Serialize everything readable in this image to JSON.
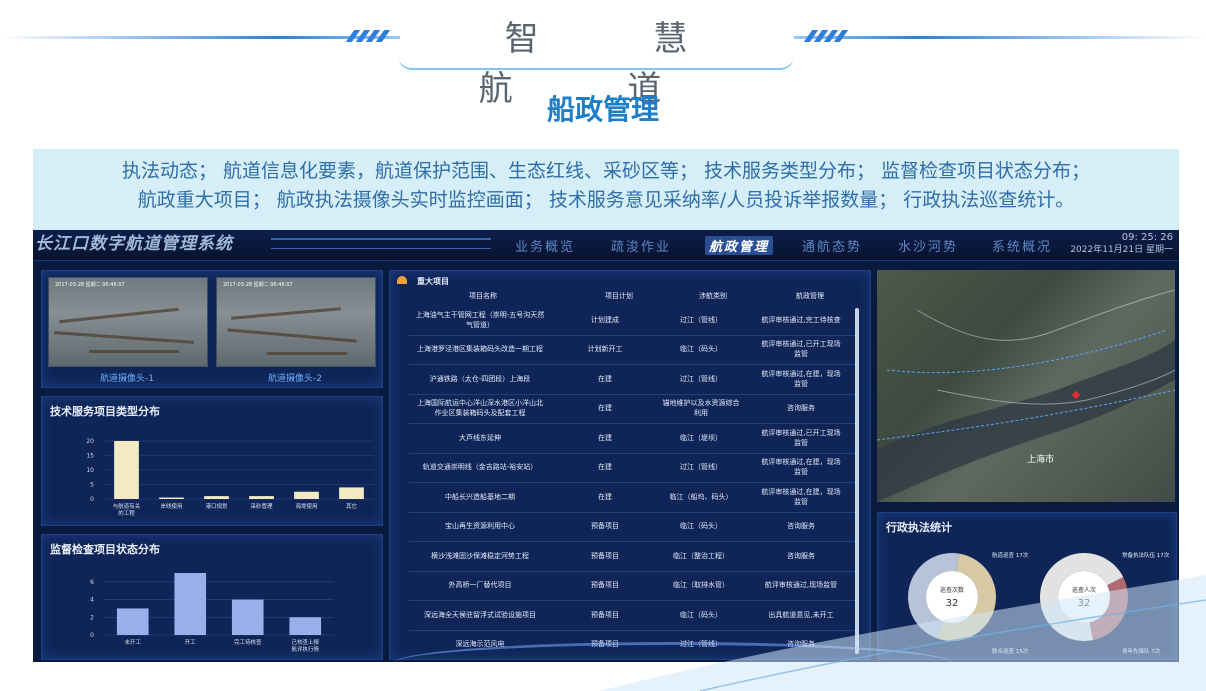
{
  "banner": {
    "title": "智 慧 航 道"
  },
  "section_title": "船政管理",
  "description": {
    "line1": "执法动态； 航道信息化要素，航道保护范围、生态红线、采砂区等； 技术服务类型分布； 监督检查项目状态分布；",
    "line2": "航政重大项目； 航政执法摄像头实时监控画面； 技术服务意见采纳率/人员投诉举报数量； 行政执法巡查统计。"
  },
  "dashboard": {
    "system_title": "长江口数字航道管理系统",
    "nav": [
      {
        "label": "业务概览",
        "active": false
      },
      {
        "label": "疏浚作业",
        "active": false
      },
      {
        "label": "航政管理",
        "active": true
      },
      {
        "label": "通航态势",
        "active": false
      },
      {
        "label": "水沙河势",
        "active": false
      },
      {
        "label": "系统概况",
        "active": false
      }
    ],
    "clock": {
      "time": "09: 25: 26",
      "date": "2022年11月21日 星期一"
    },
    "cameras": [
      {
        "label": "航道摄像头-1",
        "timestamp": "2017-03-28 星期二 06:46:07"
      },
      {
        "label": "航道摄像头-2",
        "timestamp": "2017-03-28 星期二 06:46:07"
      }
    ],
    "tech_service": {
      "title": "技术服务项目类型分布",
      "chart_data": {
        "type": "bar",
        "categories": [
          "与航道有关的工程",
          "岸线使用",
          "港口规划",
          "采砂管理",
          "海堤使用",
          "其它"
        ],
        "values": [
          20,
          0.5,
          1,
          1,
          2.5,
          4
        ],
        "ylim": [
          0,
          20
        ],
        "yticks": [
          "20",
          "15",
          "10",
          "5",
          "0"
        ],
        "xlabel": "",
        "ylabel": "",
        "grid": true,
        "bar_color": "#f1eac2"
      }
    },
    "inspection_status": {
      "title": "监督检查项目状态分布",
      "chart_data": {
        "type": "bar",
        "categories": [
          "未开工",
          "开工",
          "完工待核查",
          "已核查上报航评执行情况"
        ],
        "values": [
          3,
          7,
          4,
          2
        ],
        "ylim": [
          0,
          7
        ],
        "yticks": [
          "6",
          "4",
          "2",
          "0"
        ],
        "xlabel": "",
        "ylabel": "",
        "grid": true,
        "bar_color": "#9ab0ea"
      }
    },
    "major_projects": {
      "title": "重大项目",
      "columns": [
        "项目名称",
        "项目计划",
        "涉航类别",
        "航政管理"
      ],
      "rows": [
        [
          "上海油气主干管网工程（崇明-五号沟天然气管道）",
          "计划建成",
          "过江（管线）",
          "航评审核通过,完工待核查"
        ],
        [
          "上海港罗泾港区集装箱码头改造一期工程",
          "计划新开工",
          "临江（码头）",
          "航评审核通过,已开工现场监管"
        ],
        [
          "沪通铁路（太仓-四团段）上海段",
          "在建",
          "过江（管线）",
          "航评审核通过,在建，现场监管"
        ],
        [
          "上海国际航运中心洋山深水港区小洋山北作业区集装箱码头及配套工程",
          "在建",
          "锚地维护以及水资源综合利用",
          "咨询服务"
        ],
        [
          "大芦线东延伸",
          "在建",
          "临江（堤坝）",
          "航评审核通过,已开工现场监管"
        ],
        [
          "轨道交通崇明线（金吉路站-裕安站）",
          "在建",
          "过江（管线）",
          "航评审核通过,在建，现场监管"
        ],
        [
          "中船长兴造船基地二期",
          "在建",
          "临江（船坞、码头）",
          "航评审核通过,在建，现场监管"
        ],
        [
          "宝山再生资源利用中心",
          "预备项目",
          "临江（码头）",
          "咨询服务"
        ],
        [
          "横沙浅滩固沙保滩稳定河势工程",
          "预备项目",
          "临江（整治工程）",
          "咨询服务"
        ],
        [
          "外高桥一厂替代项目",
          "预备项目",
          "临江（取排水管）",
          "航评审核通过,现场监管"
        ],
        [
          "深远海全天候驻留浮式试验设施项目",
          "预备项目",
          "临江（码头）",
          "出具航道意见,未开工"
        ],
        [
          "深远海示范风电",
          "预备项目",
          "过江（管线）",
          "咨询服务"
        ]
      ]
    },
    "map": {
      "place_label": "上海市"
    },
    "enforcement": {
      "title": "行政执法统计",
      "donuts": [
        {
          "center_label": "巡查次数",
          "center_value": "32",
          "slices": [
            {
              "name": "航道巡查",
              "value": 17,
              "color": "#d8c9a5",
              "label": "航道巡查 17次"
            },
            {
              "name": "联合巡查",
              "value": 15,
              "color": "#b8c2d8",
              "label": "联合巡查 15次"
            }
          ]
        },
        {
          "center_label": "巡查人次",
          "center_value": "32",
          "slices": [
            {
              "name": "青年先锋队",
              "value": 7,
              "color": "#b06b70",
              "label": "青年先锋队 7次"
            },
            {
              "name": "常备执法队伍",
              "value": 17,
              "color": "#e2e2e2",
              "label": "常备执法队伍 17次"
            }
          ]
        }
      ]
    }
  }
}
